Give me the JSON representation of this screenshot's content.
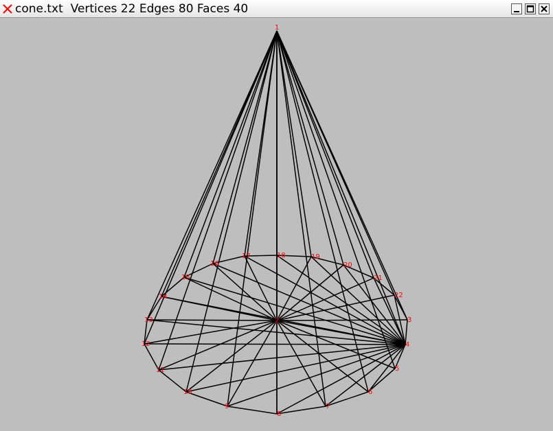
{
  "window": {
    "title": "cone.txt  Vertices 22 Edges 80 Faces 40"
  },
  "titlebar_buttons": {
    "minimize_icon": "minimize-icon",
    "maximize_icon": "maximize-icon",
    "close_icon": "close-icon"
  },
  "colors": {
    "background": "#bebebe",
    "edge": "#000000",
    "vertex_label": "#ff0000",
    "app_icon": "#ff0000"
  },
  "mesh": {
    "apex": {
      "id": "1"
    },
    "center": {
      "id": "2"
    },
    "rim_labels": [
      "3",
      "4",
      "5",
      "6",
      "7",
      "8",
      "9",
      "10",
      "11",
      "12",
      "13",
      "14",
      "15",
      "16",
      "17",
      "18",
      "19",
      "20",
      "21",
      "22"
    ]
  }
}
